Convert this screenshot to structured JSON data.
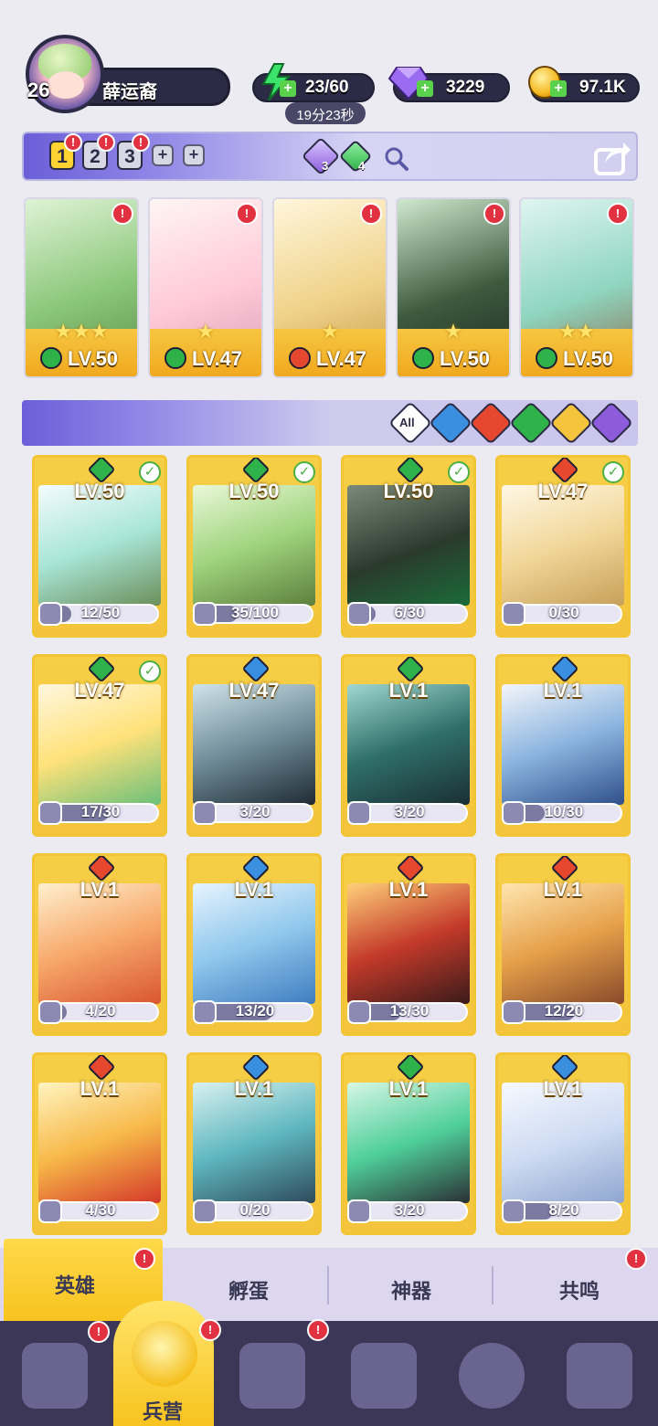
{
  "player": {
    "level": "26",
    "name": "薛运裔"
  },
  "resources": {
    "energy": "23/60",
    "energy_timer": "19分23秒",
    "gems": "3229",
    "gold": "97.1K"
  },
  "team_bar": {
    "tabs": [
      "1",
      "2",
      "3"
    ],
    "gem_purple_count": "3",
    "gem_green_count": "4"
  },
  "team_heroes": [
    {
      "level": "LV.50",
      "stars": "★★★",
      "element": "nature"
    },
    {
      "level": "LV.47",
      "stars": "★",
      "element": "nature"
    },
    {
      "level": "LV.47",
      "stars": "★",
      "element": "fire"
    },
    {
      "level": "LV.50",
      "stars": "★",
      "element": "nature"
    },
    {
      "level": "LV.50",
      "stars": "★★",
      "element": "nature"
    }
  ],
  "filter": {
    "all_label": "All"
  },
  "heroes": [
    {
      "level": "LV.50",
      "fragments": "12/50",
      "progress": 0.24,
      "element": "nature",
      "checked": true
    },
    {
      "level": "LV.50",
      "fragments": "35/100",
      "progress": 0.35,
      "element": "nature",
      "checked": true
    },
    {
      "level": "LV.50",
      "fragments": "6/30",
      "progress": 0.2,
      "element": "nature",
      "checked": true
    },
    {
      "level": "LV.47",
      "fragments": "0/30",
      "progress": 0.0,
      "element": "fire",
      "checked": true
    },
    {
      "level": "LV.47",
      "fragments": "17/30",
      "progress": 0.57,
      "element": "nature",
      "checked": true
    },
    {
      "level": "LV.47",
      "fragments": "3/20",
      "progress": 0.15,
      "element": "water",
      "checked": false
    },
    {
      "level": "LV.1",
      "fragments": "3/20",
      "progress": 0.15,
      "element": "nature",
      "checked": false
    },
    {
      "level": "LV.1",
      "fragments": "10/30",
      "progress": 0.33,
      "element": "water",
      "checked": false
    },
    {
      "level": "LV.1",
      "fragments": "4/20",
      "progress": 0.2,
      "element": "fire",
      "checked": false
    },
    {
      "level": "LV.1",
      "fragments": "13/20",
      "progress": 0.65,
      "element": "water",
      "checked": false
    },
    {
      "level": "LV.1",
      "fragments": "13/30",
      "progress": 0.43,
      "element": "fire",
      "checked": false
    },
    {
      "level": "LV.1",
      "fragments": "12/20",
      "progress": 0.6,
      "element": "fire",
      "checked": false
    },
    {
      "level": "LV.1",
      "fragments": "4/30",
      "progress": 0.13,
      "element": "fire",
      "checked": false
    },
    {
      "level": "LV.1",
      "fragments": "0/20",
      "progress": 0.0,
      "element": "water",
      "checked": false
    },
    {
      "level": "LV.1",
      "fragments": "3/20",
      "progress": 0.15,
      "element": "nature",
      "checked": false
    },
    {
      "level": "LV.1",
      "fragments": "8/20",
      "progress": 0.4,
      "element": "water",
      "checked": false
    }
  ],
  "sub_tabs": [
    "英雄",
    "孵蛋",
    "神器",
    "共鸣"
  ],
  "bottom_nav": {
    "active_label": "兵营"
  },
  "colors": {
    "nature": "#2fb24a",
    "fire": "#e5482f",
    "water": "#3a8fe0",
    "gold": "#f3c43c",
    "purple": "#8c5cdc",
    "dark": "#2c2b45"
  }
}
